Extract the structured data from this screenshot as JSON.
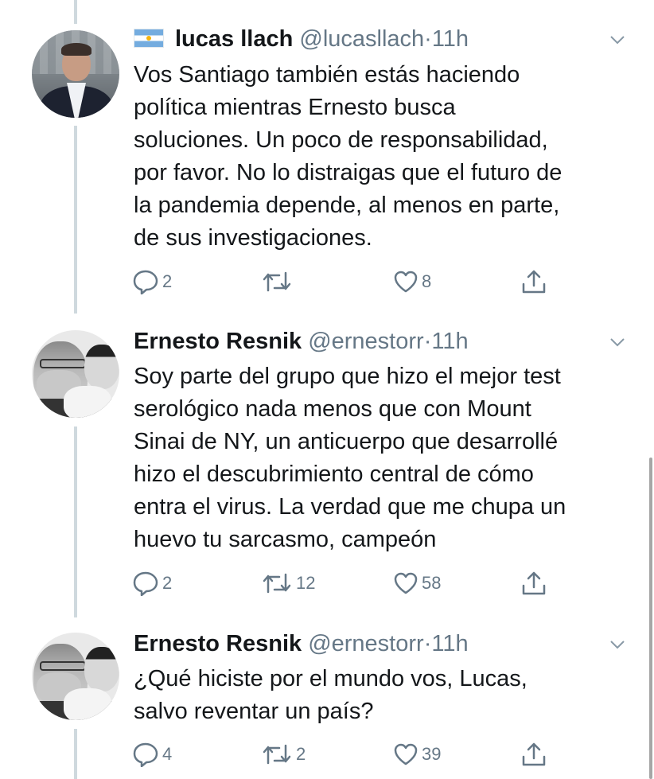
{
  "tweets": [
    {
      "flag": "argentina-flag",
      "name": "lucas llach",
      "handle": "@lucasllach",
      "separator": "·",
      "time": "11h",
      "text": "Vos Santiago también estás haciendo\npolítica mientras Ernesto busca\nsoluciones. Un poco de responsabilidad,\npor favor. No lo distraigas que el futuro de\nla pandemia depende, al menos en parte,\nde sus investigaciones.",
      "replies": "2",
      "retweets": "",
      "likes": "8"
    },
    {
      "name": "Ernesto Resnik",
      "handle": "@ernestorr",
      "separator": "·",
      "time": "11h",
      "text": "Soy parte del grupo que hizo el mejor test\nserológico nada menos que con Mount\nSinai de NY, un anticuerpo que desarrollé\nhizo el descubrimiento central de cómo\nentra el virus. La verdad que me chupa un\nhuevo tu sarcasmo, campeón",
      "replies": "2",
      "retweets": "12",
      "likes": "58"
    },
    {
      "name": "Ernesto Resnik",
      "handle": "@ernestorr",
      "separator": "·",
      "time": "11h",
      "text": "¿Qué hiciste por el mundo vos, Lucas,\nsalvo reventar un país?",
      "replies": "4",
      "retweets": "2",
      "likes": "39"
    }
  ],
  "icons": {
    "reply": "reply-icon",
    "retweet": "retweet-icon",
    "like": "heart-icon",
    "share": "share-icon",
    "menu": "chevron-down-icon"
  },
  "colors": {
    "text": "#14171a",
    "secondary": "#657786",
    "thread_line": "#cfd9de"
  }
}
